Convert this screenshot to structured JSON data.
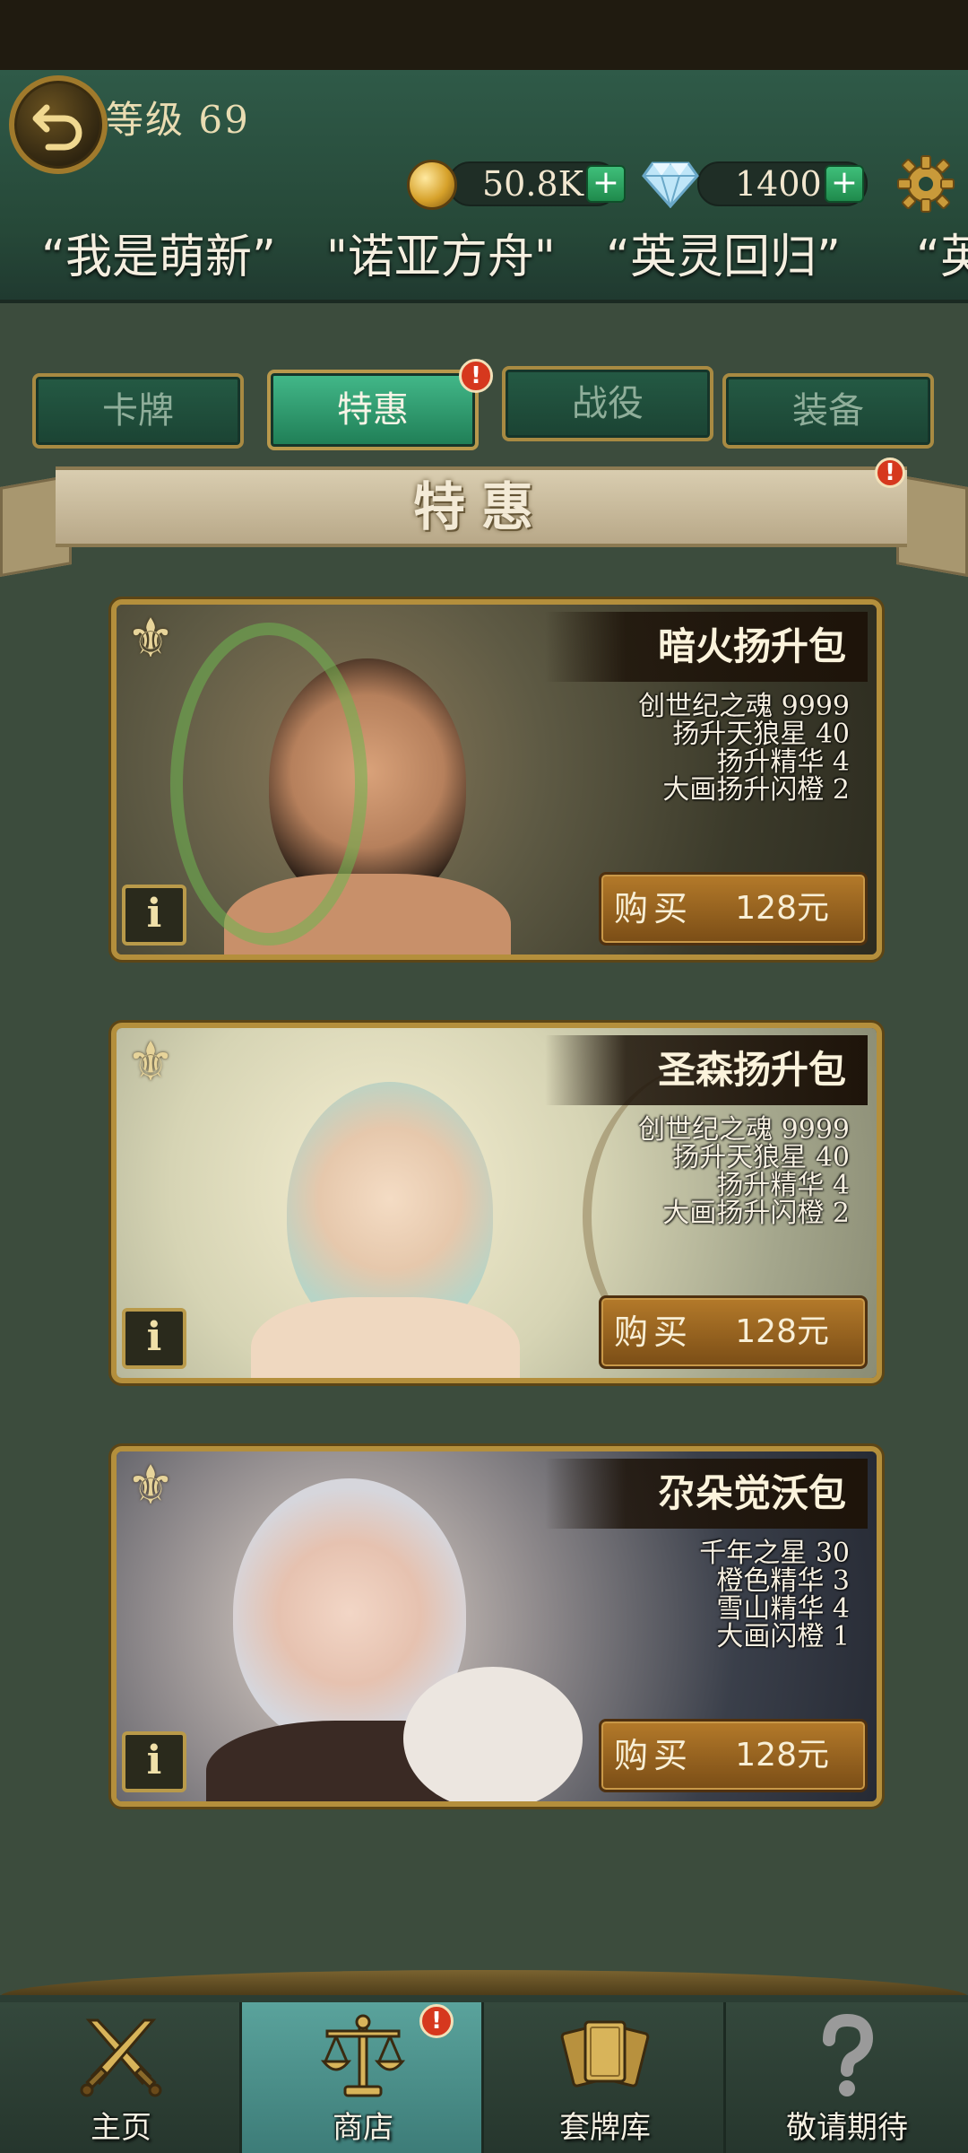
{
  "header": {
    "level_label": "等级 69",
    "gold_value": "50.8K",
    "gem_value": "1400",
    "plus_symbol": "+",
    "marquee_items": [
      "“我是萌新”",
      "\"诺亚方舟\"",
      "“英灵回归”",
      "“英"
    ]
  },
  "tabs": [
    {
      "label": "卡牌",
      "active": false
    },
    {
      "label": "特惠",
      "active": true,
      "badge": "!"
    },
    {
      "label": "战役",
      "active": false
    },
    {
      "label": "装备",
      "active": false
    }
  ],
  "section": {
    "title": "特惠",
    "badge": "!"
  },
  "packs": [
    {
      "title": "暗火扬升包",
      "contents": [
        "创世纪之魂 9999",
        "扬升天狼星 40",
        "扬升精华 4",
        "大画扬升闪橙 2"
      ],
      "buy_label": "购买",
      "price": "128元",
      "info_label": "i"
    },
    {
      "title": "圣森扬升包",
      "contents": [
        "创世纪之魂 9999",
        "扬升天狼星 40",
        "扬升精华 4",
        "大画扬升闪橙 2"
      ],
      "buy_label": "购买",
      "price": "128元",
      "info_label": "i"
    },
    {
      "title": "尕朵觉沃包",
      "contents": [
        "千年之星 30",
        "橙色精华 3",
        "雪山精华 4",
        "大画闪橙 1"
      ],
      "buy_label": "购买",
      "price": "128元",
      "info_label": "i"
    }
  ],
  "bottom_nav": [
    {
      "label": "主页",
      "icon": "crossed-swords-icon",
      "active": false
    },
    {
      "label": "商店",
      "icon": "scales-icon",
      "active": true,
      "badge": "!"
    },
    {
      "label": "套牌库",
      "icon": "card-deck-icon",
      "active": false
    },
    {
      "label": "敬请期待",
      "icon": "question-mark-icon",
      "active": false
    }
  ],
  "colors": {
    "accent_gold": "#b48f3c",
    "tab_active": "#2f9a6c",
    "alert_red": "#d6381e",
    "nav_active": "#4a8e88"
  }
}
